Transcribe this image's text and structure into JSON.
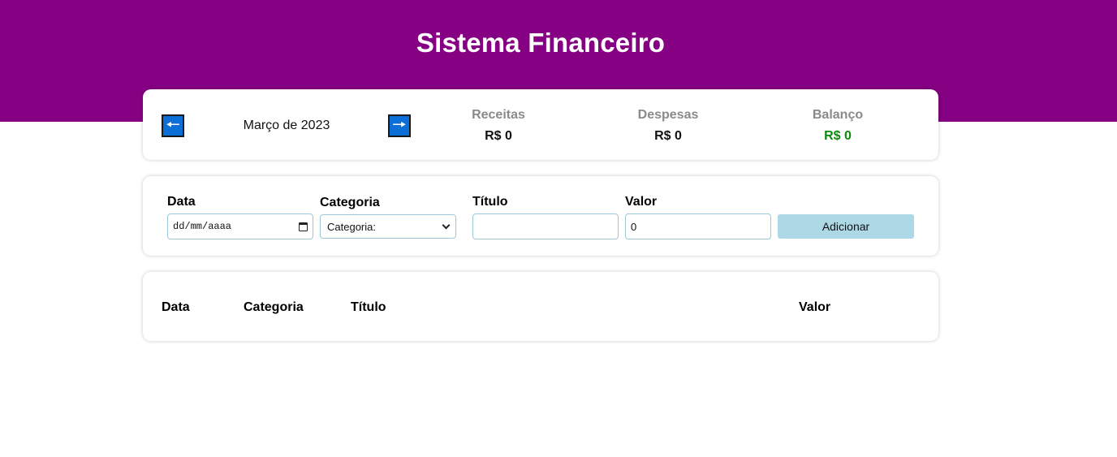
{
  "header": {
    "title": "Sistema Financeiro"
  },
  "colors": {
    "header_bg": "#850082",
    "arrow_button": "#0c6fd8",
    "balance_positive": "#0d8a0d",
    "add_button": "#add8e6"
  },
  "info": {
    "prev_icon": "arrow-left-icon",
    "next_icon": "arrow-right-icon",
    "prev_glyph": "🠔",
    "next_glyph": "🠖",
    "month": "Março de 2023",
    "receitas": {
      "label": "Receitas",
      "value": "R$ 0"
    },
    "despesas": {
      "label": "Despesas",
      "value": "R$ 0"
    },
    "balanco": {
      "label": "Balanço",
      "value": "R$ 0"
    }
  },
  "form": {
    "date": {
      "label": "Data",
      "placeholder": "dd/mm/aaaa"
    },
    "category": {
      "label": "Categoria",
      "selected": "Categoria:"
    },
    "title": {
      "label": "Título",
      "value": ""
    },
    "value": {
      "label": "Valor",
      "value": "0"
    },
    "submit_label": "Adicionar"
  },
  "table": {
    "columns": [
      "Data",
      "Categoria",
      "Título",
      "Valor"
    ],
    "rows": []
  }
}
